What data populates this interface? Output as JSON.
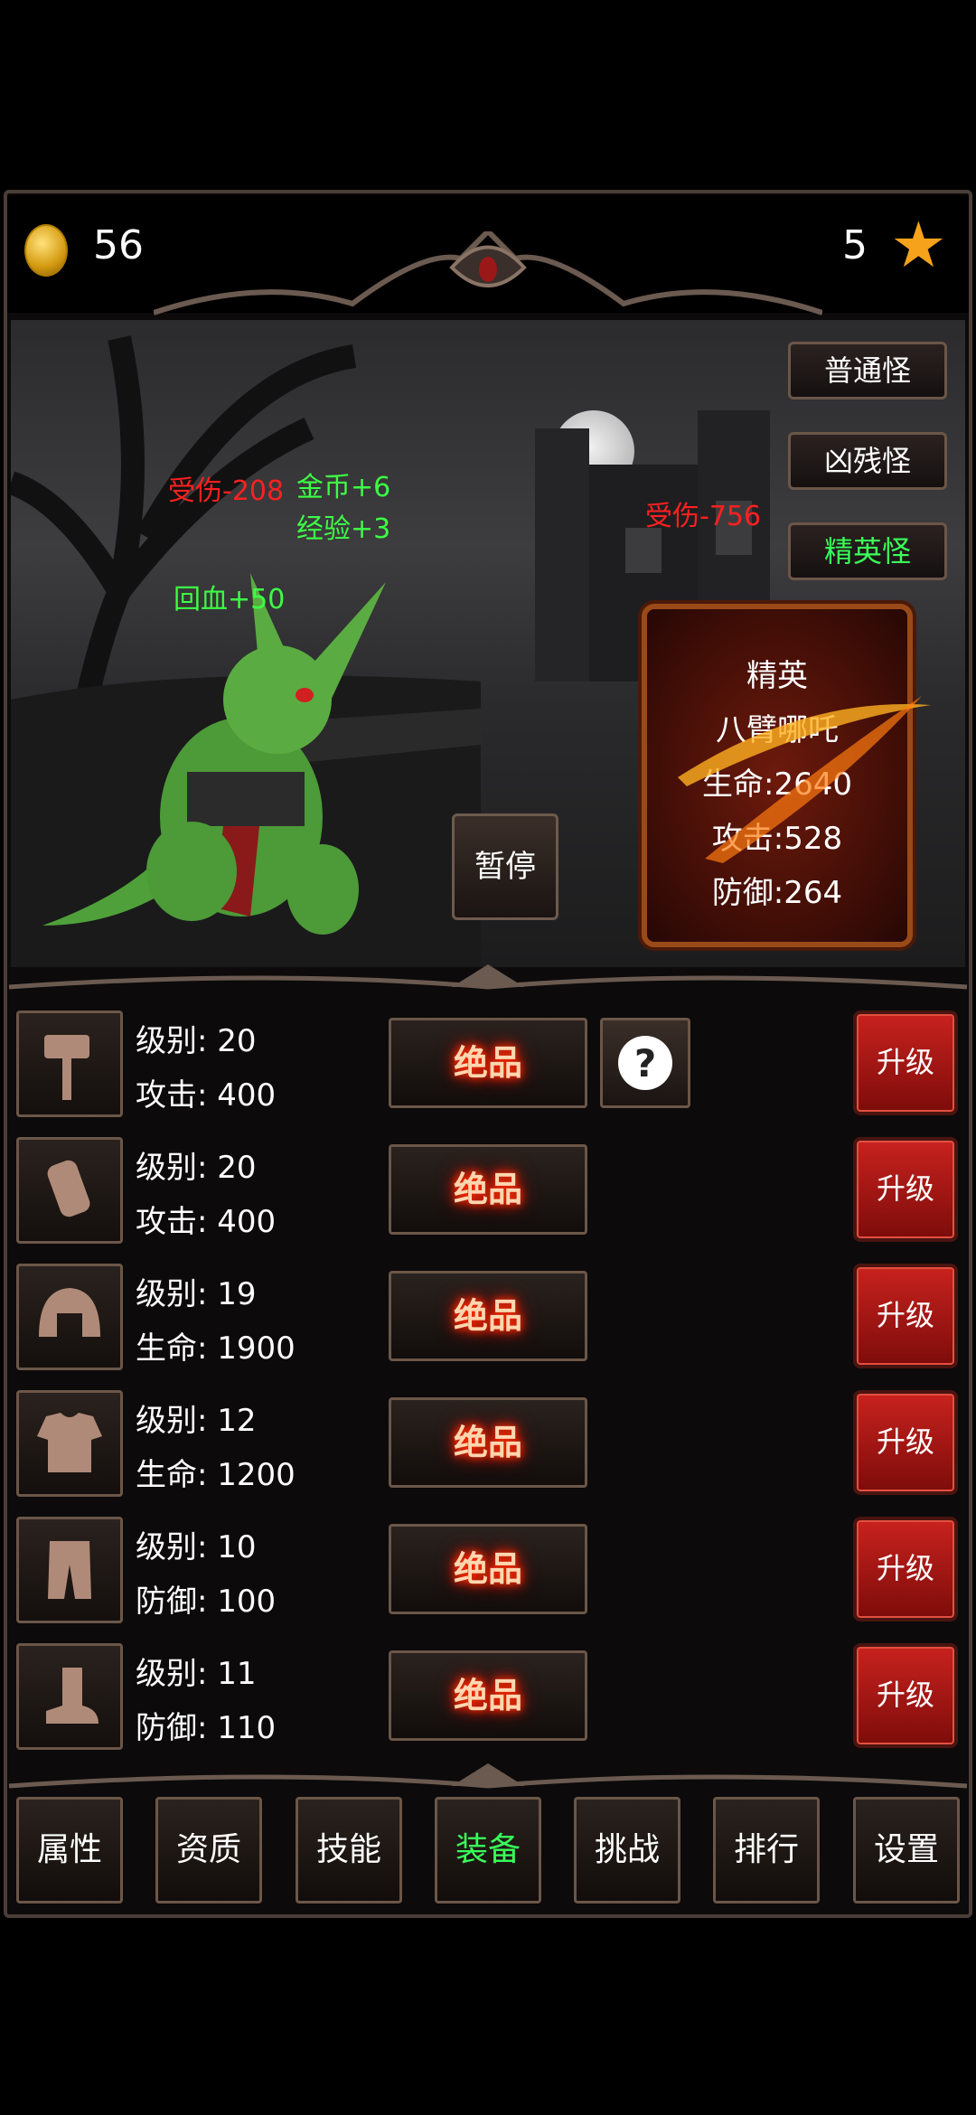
{
  "header": {
    "coins": "56",
    "stars": "5"
  },
  "monster_types": [
    {
      "label": "普通怪",
      "active": false
    },
    {
      "label": "凶残怪",
      "active": false
    },
    {
      "label": "精英怪",
      "active": true
    }
  ],
  "combat_text": {
    "player_damage": "受伤-208",
    "gold_gain": "金币+6",
    "exp_gain": "经验+3",
    "heal": "回血+50",
    "enemy_damage": "受伤-756"
  },
  "pause_label": "暂停",
  "enemy": {
    "rank": "精英",
    "name": "八臂哪吒",
    "hp": "生命:2640",
    "attack": "攻击:528",
    "defense": "防御:264"
  },
  "equipment": [
    {
      "icon": "hammer-icon",
      "level": "级别: 20",
      "stat": "攻击: 400",
      "quality": "绝品",
      "upgrade": "升级",
      "has_help": true
    },
    {
      "icon": "bracer-icon",
      "level": "级别: 20",
      "stat": "攻击: 400",
      "quality": "绝品",
      "upgrade": "升级",
      "has_help": false
    },
    {
      "icon": "helmet-icon",
      "level": "级别: 19",
      "stat": "生命: 1900",
      "quality": "绝品",
      "upgrade": "升级",
      "has_help": false
    },
    {
      "icon": "armor-icon",
      "level": "级别: 12",
      "stat": "生命: 1200",
      "quality": "绝品",
      "upgrade": "升级",
      "has_help": false
    },
    {
      "icon": "pants-icon",
      "level": "级别: 10",
      "stat": "防御: 100",
      "quality": "绝品",
      "upgrade": "升级",
      "has_help": false
    },
    {
      "icon": "boots-icon",
      "level": "级别: 11",
      "stat": "防御: 110",
      "quality": "绝品",
      "upgrade": "升级",
      "has_help": false
    }
  ],
  "tabs": [
    {
      "label": "属性",
      "active": false
    },
    {
      "label": "资质",
      "active": false
    },
    {
      "label": "技能",
      "active": false
    },
    {
      "label": "装备",
      "active": true
    },
    {
      "label": "挑战",
      "active": false
    },
    {
      "label": "排行",
      "active": false
    },
    {
      "label": "设置",
      "active": false
    }
  ],
  "colors": {
    "damage": "#ff2020",
    "gain": "#3cff45",
    "upgrade": "#c8221e",
    "star": "#f6a21a"
  }
}
